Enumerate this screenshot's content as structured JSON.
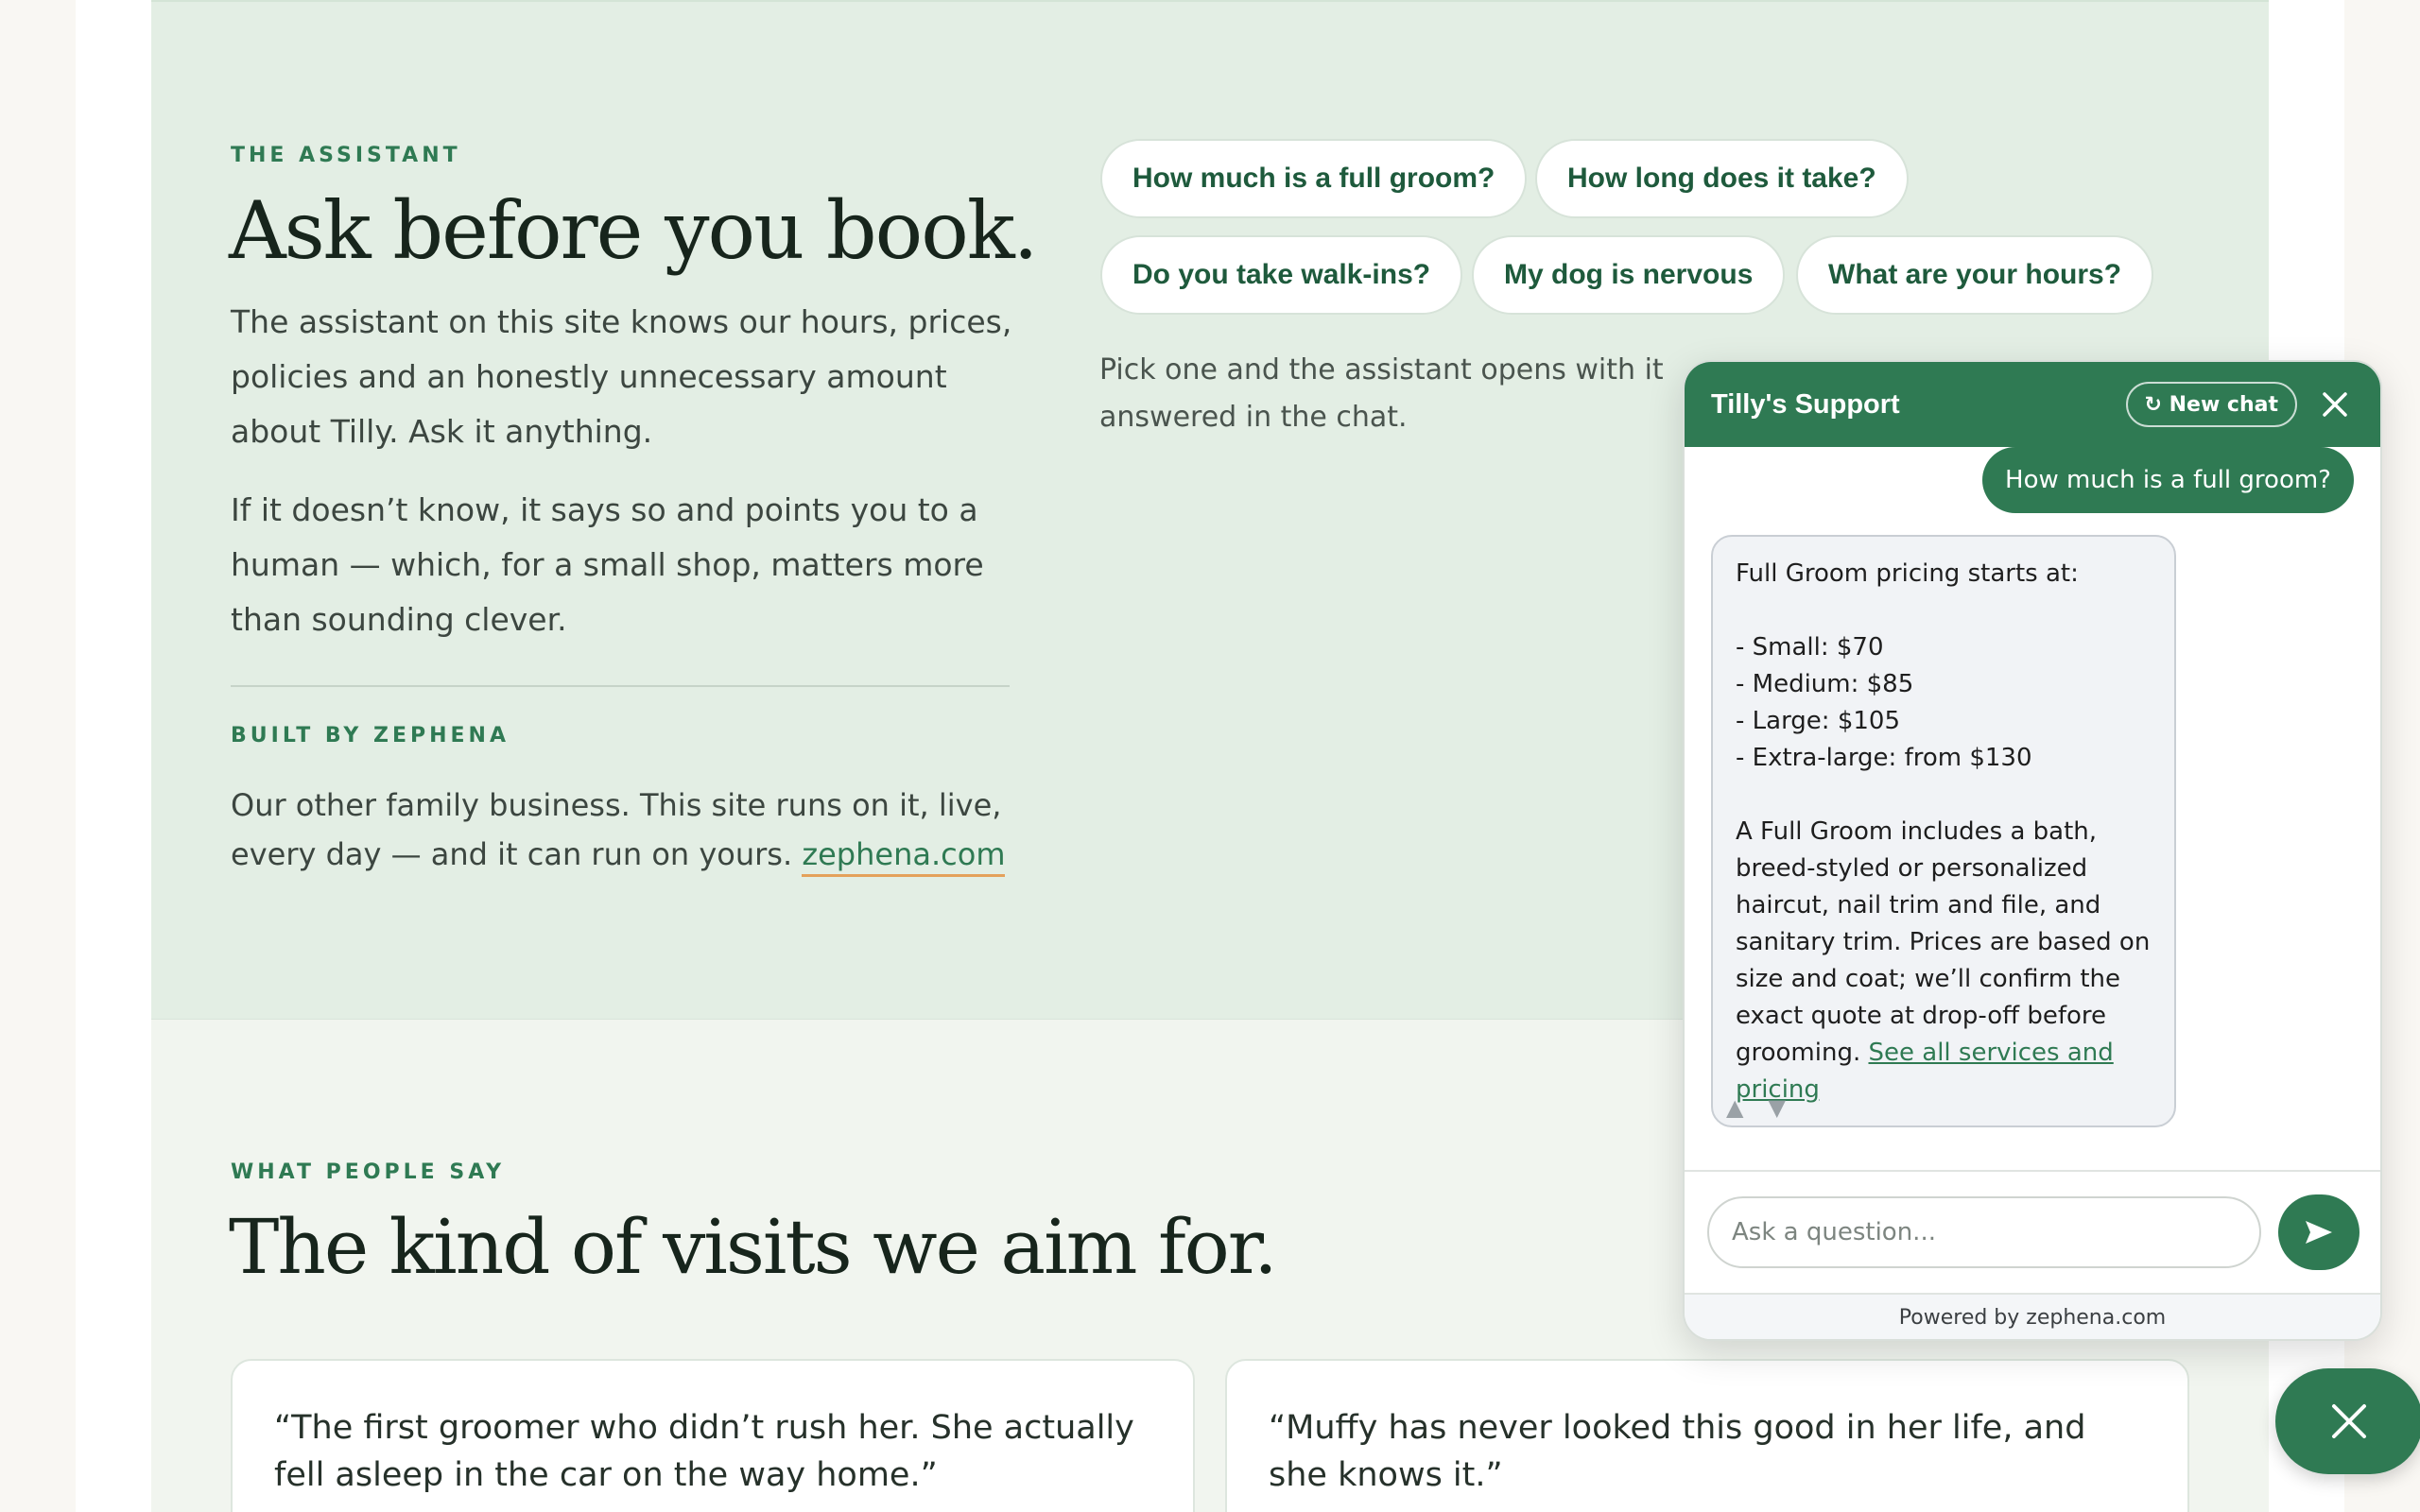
{
  "assistant_section": {
    "eyebrow": "THE ASSISTANT",
    "headline": "Ask before you book.",
    "paragraph_1": "The assistant on this site knows our hours, prices, policies and an honestly unnecessary amount about Tilly. Ask it anything.",
    "paragraph_2": "If it doesn’t know, it says so and points you to a human — which, for a small shop, matters more than sounding clever.",
    "built_by_eyebrow": "BUILT BY ZEPHENA",
    "built_by_text": "Our other family business. This site runs on it, live, every day — and it can run on yours.",
    "built_by_link": "zephena.com",
    "chips": [
      "How much is a full groom?",
      "How long does it take?",
      "Do you take walk-ins?",
      "My dog is nervous",
      "What are your hours?"
    ],
    "hint_text": "Pick one and the assistant opens with it answered in the chat."
  },
  "people_section": {
    "eyebrow": "WHAT PEOPLE SAY",
    "headline": "The kind of visits we aim for.",
    "testimonials": [
      "“The first groomer who didn’t rush her. She actually fell asleep in the car on the way home.”",
      "“Muffy has never looked this good in her life, and she knows it.”"
    ]
  },
  "chat": {
    "title": "Tilly's Support",
    "new_chat_label": "↻ New chat",
    "close_icon": "close-icon",
    "user_message": "How much is a full groom?",
    "bot_lines": [
      "Full Groom pricing starts at:",
      "",
      "- Small: $70",
      "- Medium: $85",
      "- Large: $105",
      "- Extra-large: from $130",
      ""
    ],
    "bot_paragraph": "A Full Groom includes a bath, breed-styled or personalized haircut, nail trim and file, and sanitary trim. Prices are based on size and coat; we’ll confirm the exact quote at drop-off before grooming.",
    "bot_link": "See all services and pricing",
    "thumbs_up": "▲",
    "thumbs_down": "▼",
    "input_placeholder": "Ask a question...",
    "send_icon": "send-icon",
    "footer": "Powered by zephena.com"
  },
  "fab": {
    "icon": "close-icon"
  },
  "colors": {
    "brand_green": "#2f7a53",
    "assist_bg": "#e3eee4",
    "people_bg": "#f1f5ef",
    "link_underline": "#e4a15b"
  }
}
